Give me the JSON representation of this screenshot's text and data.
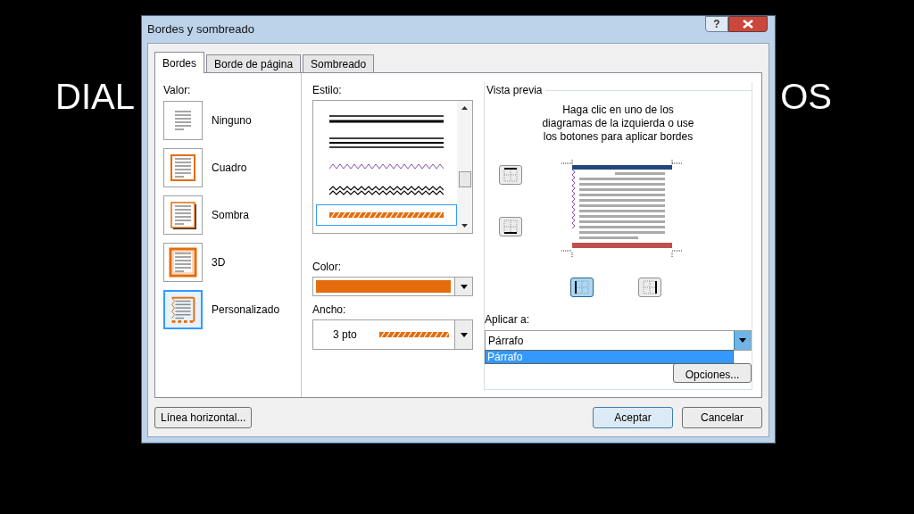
{
  "slide": {
    "title_left": "DIAL",
    "title_right": "OS"
  },
  "window": {
    "title": "Bordes y sombreado",
    "help": "?"
  },
  "tabs": [
    {
      "label": "Bordes",
      "selected": true
    },
    {
      "label": "Borde de página",
      "selected": false
    },
    {
      "label": "Sombreado",
      "selected": false
    }
  ],
  "setting": {
    "label": "Valor:",
    "items": [
      {
        "label": "Ninguno",
        "kind": "none",
        "selected": false
      },
      {
        "label": "Cuadro",
        "kind": "box",
        "selected": false
      },
      {
        "label": "Sombra",
        "kind": "shadow",
        "selected": false
      },
      {
        "label": "3D",
        "kind": "framed",
        "selected": false
      },
      {
        "label": "Personalizado",
        "kind": "custom",
        "selected": true
      }
    ]
  },
  "style": {
    "label": "Estilo:",
    "options": [
      {
        "kind": "thin-thick",
        "selected": false
      },
      {
        "kind": "triple",
        "selected": false
      },
      {
        "kind": "wave",
        "selected": false
      },
      {
        "kind": "double-wave",
        "selected": false
      },
      {
        "kind": "hatched",
        "selected": true
      }
    ]
  },
  "color": {
    "label": "Color:",
    "color": "#e46c0a"
  },
  "line_width": {
    "label": "Ancho:",
    "value": "3 pto"
  },
  "preview": {
    "title": "Vista previa",
    "hint_lines": [
      "Haga clic en uno de los",
      "diagramas de la izquierda o use",
      "los botones para aplicar bordes"
    ],
    "edge_buttons": [
      {
        "kind": "top",
        "selected": false
      },
      {
        "kind": "bottom",
        "selected": false
      },
      {
        "kind": "left",
        "selected": true
      },
      {
        "kind": "right",
        "selected": false
      }
    ]
  },
  "apply_to": {
    "label": "Aplicar a:",
    "value": "Párrafo",
    "options": [
      {
        "label": "Párrafo",
        "selected": true
      }
    ]
  },
  "options_button": "Opciones...",
  "footer": {
    "horizontal_line": "Línea horizontal...",
    "ok": "Aceptar",
    "cancel": "Cancelar"
  }
}
